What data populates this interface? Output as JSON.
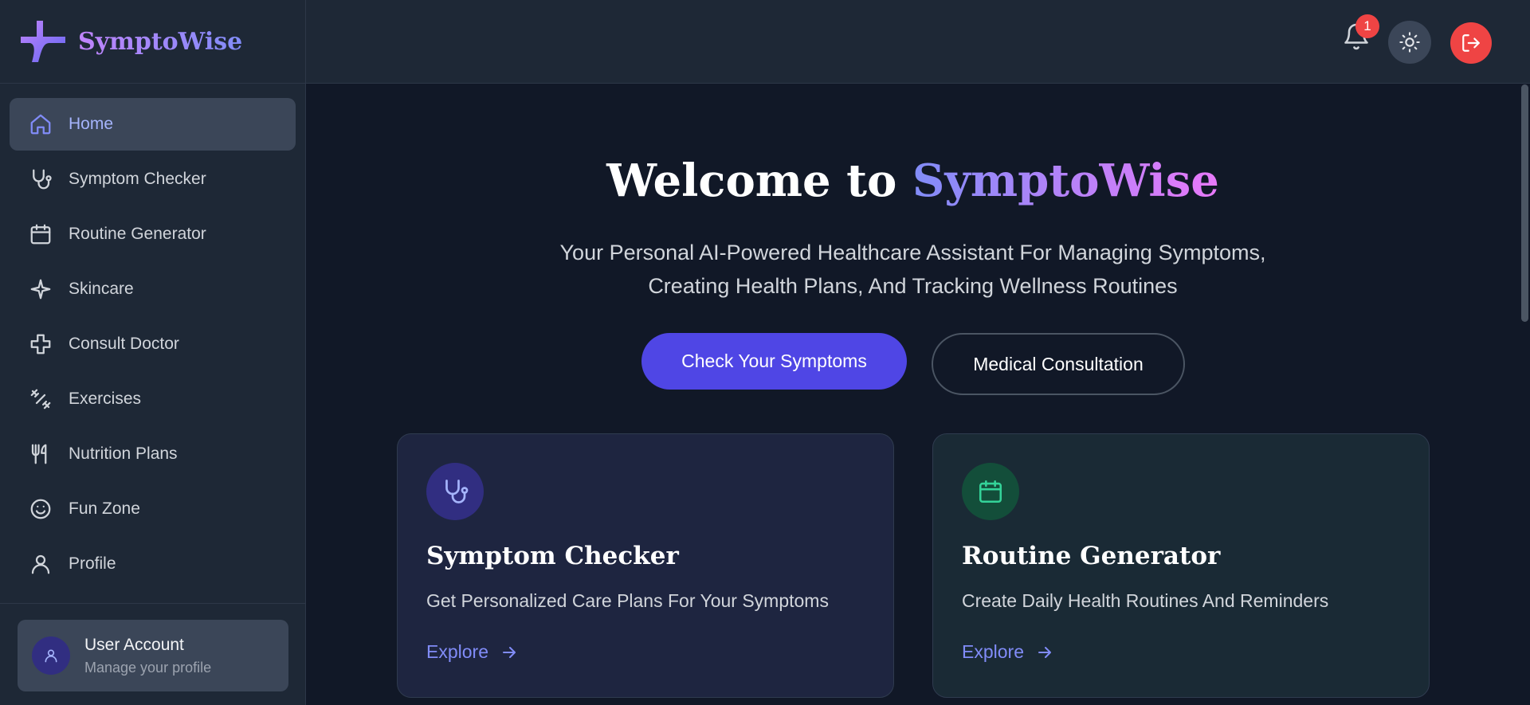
{
  "app": {
    "name": "SymptoWise",
    "accent": "#4f46e5",
    "danger": "#ef4444"
  },
  "sidebar": {
    "items": [
      {
        "label": "Home",
        "icon": "home-icon",
        "active": true
      },
      {
        "label": "Symptom Checker",
        "icon": "stethoscope-icon"
      },
      {
        "label": "Routine Generator",
        "icon": "calendar-icon"
      },
      {
        "label": "Skincare",
        "icon": "sparkle-icon"
      },
      {
        "label": "Consult Doctor",
        "icon": "medical-cross-icon"
      },
      {
        "label": "Exercises",
        "icon": "dumbbell-icon"
      },
      {
        "label": "Nutrition Plans",
        "icon": "utensils-icon"
      },
      {
        "label": "Fun Zone",
        "icon": "smile-icon"
      },
      {
        "label": "Profile",
        "icon": "user-icon"
      }
    ],
    "user_card": {
      "title": "User Account",
      "subtitle": "Manage your profile"
    }
  },
  "topbar": {
    "notification_count": "1"
  },
  "hero": {
    "title_prefix": "Welcome to ",
    "title_brand": "SymptoWise",
    "subtitle_line1": "Your Personal AI-Powered Healthcare Assistant For Managing Symptoms,",
    "subtitle_line2": "Creating Health Plans, And Tracking Wellness Routines",
    "primary_button": "Check Your Symptoms",
    "secondary_button": "Medical Consultation"
  },
  "cards": [
    {
      "title": "Symptom Checker",
      "description": "Get Personalized Care Plans For Your Symptoms",
      "link": "Explore",
      "icon": "stethoscope-icon"
    },
    {
      "title": "Routine Generator",
      "description": "Create Daily Health Routines And Reminders",
      "link": "Explore",
      "icon": "calendar-icon"
    }
  ]
}
